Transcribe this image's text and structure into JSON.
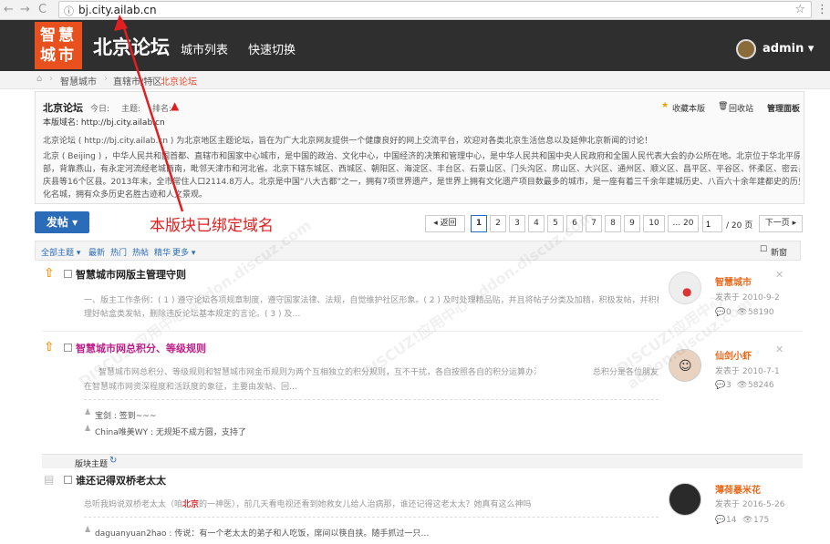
{
  "browser": {
    "url": "bj.city.ailab.cn",
    "back": "←",
    "forward": "→",
    "reload": "C",
    "star": "☆",
    "menu": "⋮"
  },
  "header": {
    "logo": "智慧城市",
    "logo_line1": "智慧",
    "logo_line2": "城市",
    "title": "北京论坛",
    "nav": [
      "城市列表",
      "快速切换"
    ],
    "user": "admin"
  },
  "breadcrumb": {
    "items": [
      "智慧城市",
      "直辖市/特区",
      "北京论坛"
    ],
    "sep": "›"
  },
  "forum": {
    "name": "北京论坛",
    "today_label": "今日:",
    "topic_label": "主题:",
    "rank_label": "排名:",
    "domain_line": "本版域名: http://bj.city.ailab.cn",
    "actions": [
      "收藏本版",
      "回收站",
      "管理面板"
    ],
    "desc1": "北京论坛 ( http://bj.city.ailab.cn ) 为北京地区主题论坛，旨在为广大北京网友提供一个健康良好的网上交流平台，欢迎对各类北京生活信息以及延伸北京新闻的讨论！",
    "desc2a": "北京 ( Beijing ) ，中华人民共和国首都、直辖市和国家中心城市，是中国的政治、文化中心，中国经济的决策和管理中心，是中华人民共和国中央人民政府和全国人民代表大会的办公所在地。北京位于华北平原的北",
    "desc2b": "部，背靠燕山，有永定河流经老城西南，毗邻天津市和河北省。北京下辖东城区、西城区、朝阳区、海淀区、丰台区、石景山区、门头沟区、房山区、大兴区、通州区、顺义区、昌平区、平谷区、怀柔区、密云县、延",
    "desc2c": "庆县等16个区县。2013年末，全市常住人口2114.8万人。北京是中国“八大古都”之一，拥有7项世界遗产，是世界上拥有文化遗产项目数最多的城市，是一座有着三千余年建城历史、八百六十余年建都史的历史文",
    "desc2d": "化名城，拥有众多历史名胜古迹和人文景观。"
  },
  "toolbar": {
    "post": "发帖",
    "bound_note": "本版块已绑定域名",
    "back": "◂ 返回",
    "pages": [
      "1",
      "2",
      "3",
      "4",
      "5",
      "6",
      "7",
      "8",
      "9",
      "10",
      "... 20"
    ],
    "page_input": "1",
    "page_total": "/ 20 页",
    "next": "下一页 ▸"
  },
  "filters": {
    "items": [
      "全部主题 ▾",
      "最新",
      "热门",
      "热帖",
      "精华",
      "更多 ▾"
    ],
    "newwin": "新窗"
  },
  "threads": [
    {
      "title": "智慧城市网版主管理守则",
      "desc1": "一、版主工作条例：( 1 ) 遵守论坛各项规章制度，遵守国家法律、法规，自觉维护社区形象。( 2 ) 及时处理精品贴，并且将帖子分类及加精，积极发帖，并积极管",
      "desc2": "理好帖盒类发帖，删除违反论坛基本规定的言论。( 3 ) 及…",
      "author": "智慧城市",
      "date": "发表于 2010-9-2",
      "replies": "0",
      "views": "58190"
    },
    {
      "title": "智慧城市网总积分、等级规则",
      "desc1": "智慧城市网总积分、等级规则和智慧城市网金币规则为两个互相独立的积分规则，互不干扰，各自按照各自的积分运算办法自动运行。",
      "desc1b": "总积分是各位朋友",
      "desc2": "在智慧城市网资深程度和活跃度的象征，主要由发帖、回…",
      "reply1": "宝剑 : 签到~~~",
      "reply2": "China唯美WY : 无规矩不成方圆，支持了",
      "author": "仙剑小虾",
      "date": "发表于 2010-7-1",
      "replies": "3",
      "views": "58246"
    },
    {
      "title": "谁还记得双桥老太太",
      "desc_pre": "总听我妈说双桥老太太（咱",
      "desc_hl": "北京",
      "desc_post": "的一神医），前几天看电视还看到她救女儿给人治病那，谁还记得这老太太？她真有这么神吗",
      "reply1": "daguanyuan2hao : 传说：有一个老太太的弟子和人吃饭，席间以筷自挟。随手抓过一只…",
      "author": "薄荷暴米花",
      "date": "发表于 2016-5-26",
      "replies": "14",
      "views": "175"
    }
  ],
  "section_label": "版块主题",
  "watermark": "DISCUZ!应用中心 addon.discuz.com"
}
